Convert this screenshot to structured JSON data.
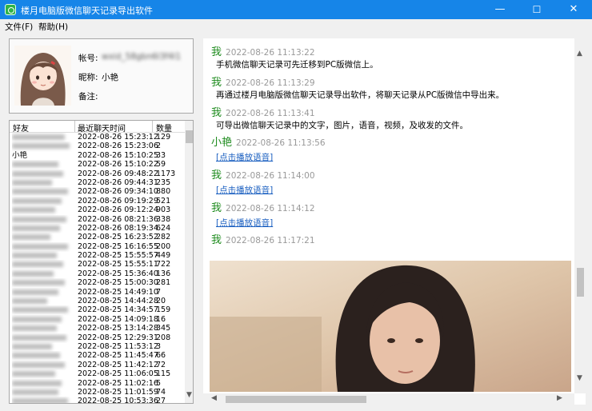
{
  "window": {
    "title": "楼月电脑版微信聊天记录导出软件",
    "controls": {
      "minimize": "—",
      "maximize": "☐",
      "close": "✕"
    }
  },
  "menu": [
    {
      "label": "文件(F)"
    },
    {
      "label": "帮助(H)"
    }
  ],
  "profile": {
    "account_label": "帐号:",
    "account_value": "wxid_58gbn6l3f4l1",
    "nickname_label": "昵称:",
    "nickname_value": "小艳",
    "remark_label": "备注:",
    "remark_value": ""
  },
  "friend_list": {
    "columns": [
      "好友",
      "最近聊天时间",
      "数量"
    ],
    "rows": [
      {
        "name": "",
        "time": "2022-08-26 15:23:12",
        "count": "129"
      },
      {
        "name": "",
        "time": "2022-08-26 15:23:06",
        "count": "2"
      },
      {
        "name": "小艳",
        "time": "2022-08-26 15:10:25",
        "count": "33"
      },
      {
        "name": "",
        "time": "2022-08-26 15:10:22",
        "count": "59"
      },
      {
        "name": "",
        "time": "2022-08-26 09:48:22",
        "count": "1173"
      },
      {
        "name": "",
        "time": "2022-08-26 09:44:31",
        "count": "235"
      },
      {
        "name": "",
        "time": "2022-08-26 09:34:10",
        "count": "880"
      },
      {
        "name": "",
        "time": "2022-08-26 09:19:29",
        "count": "521"
      },
      {
        "name": "",
        "time": "2022-08-26 09:12:24",
        "count": "903"
      },
      {
        "name": "",
        "time": "2022-08-26 08:21:36",
        "count": "338"
      },
      {
        "name": "",
        "time": "2022-08-26 08:19:34",
        "count": "624"
      },
      {
        "name": "",
        "time": "2022-08-25 16:23:52",
        "count": "282"
      },
      {
        "name": "",
        "time": "2022-08-25 16:16:55",
        "count": "200"
      },
      {
        "name": "",
        "time": "2022-08-25 15:55:57",
        "count": "449"
      },
      {
        "name": "",
        "time": "2022-08-25 15:55:11",
        "count": "722"
      },
      {
        "name": "",
        "time": "2022-08-25 15:36:40",
        "count": "136"
      },
      {
        "name": "",
        "time": "2022-08-25 15:00:30",
        "count": "281"
      },
      {
        "name": "",
        "time": "2022-08-25 14:49:10",
        "count": "7"
      },
      {
        "name": "",
        "time": "2022-08-25 14:44:28",
        "count": "20"
      },
      {
        "name": "",
        "time": "2022-08-25 14:34:57",
        "count": "159"
      },
      {
        "name": "",
        "time": "2022-08-25 14:09:18",
        "count": "16"
      },
      {
        "name": "",
        "time": "2022-08-25 13:14:28",
        "count": "345"
      },
      {
        "name": "",
        "time": "2022-08-25 12:29:31",
        "count": "208"
      },
      {
        "name": "",
        "time": "2022-08-25 11:53:12",
        "count": "3"
      },
      {
        "name": "",
        "time": "2022-08-25 11:45:47",
        "count": "66"
      },
      {
        "name": "",
        "time": "2022-08-25 11:42:12",
        "count": "72"
      },
      {
        "name": "",
        "time": "2022-08-25 11:06:05",
        "count": "115"
      },
      {
        "name": "",
        "time": "2022-08-25 11:02:16",
        "count": "5"
      },
      {
        "name": "",
        "time": "2022-08-25 11:01:59",
        "count": "74"
      },
      {
        "name": "",
        "time": "2022-08-25 10:53:36",
        "count": "27"
      }
    ]
  },
  "chat": {
    "messages": [
      {
        "sender": "我",
        "time": "2022-08-26 11:13:22",
        "text": "手机微信聊天记录可先迁移到PC版微信上。"
      },
      {
        "sender": "我",
        "time": "2022-08-26 11:13:29",
        "text": "再通过楼月电脑版微信聊天记录导出软件，将聊天记录从PC版微信中导出来。"
      },
      {
        "sender": "我",
        "time": "2022-08-26 11:13:41",
        "text": "可导出微信聊天记录中的文字，图片，语音，视频，及收发的文件。"
      },
      {
        "sender": "小艳",
        "time": "2022-08-26 11:13:56",
        "link": "[点击播放语音]"
      },
      {
        "sender": "我",
        "time": "2022-08-26 11:14:00",
        "link": "[点击播放语音]"
      },
      {
        "sender": "我",
        "time": "2022-08-26 11:14:12",
        "link": "[点击播放语音]"
      },
      {
        "sender": "我",
        "time": "2022-08-26 11:17:21"
      }
    ]
  },
  "icons": {
    "app": "wechat-icon",
    "scroll_up": "chevron-up-icon",
    "scroll_down": "chevron-down-icon",
    "scroll_left": "chevron-left-icon",
    "scroll_right": "chevron-right-icon"
  },
  "colors": {
    "titlebar": "#1685e8",
    "sender": "#1d8b1d",
    "link": "#1a5fc0"
  }
}
